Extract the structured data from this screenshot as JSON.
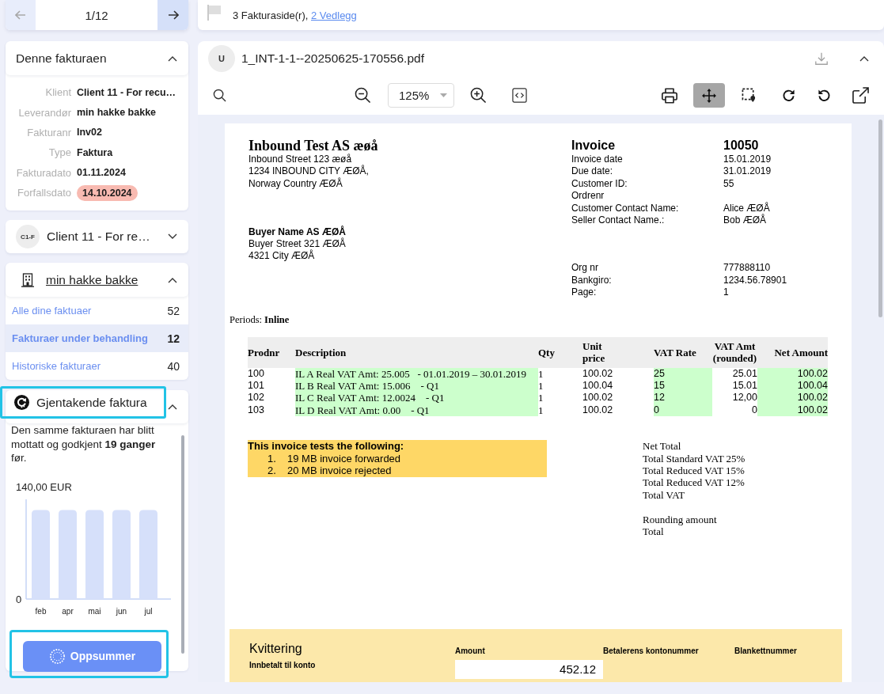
{
  "pager": {
    "position": "1/12",
    "previous_disabled": true
  },
  "invoice_card": {
    "title": "Denne fakturaen",
    "expanded": true,
    "fields": [
      {
        "label": "Klient",
        "value": "Client 11 - For recu…",
        "overdue": false
      },
      {
        "label": "Leverandør",
        "value": "min hakke bakke",
        "overdue": false
      },
      {
        "label": "Fakturanr",
        "value": "Inv02",
        "overdue": false
      },
      {
        "label": "Type",
        "value": "Faktura",
        "overdue": false
      },
      {
        "label": "Fakturadato",
        "value": "01.11.2024",
        "overdue": false
      },
      {
        "label": "Forfallsdato",
        "value": "14.10.2024",
        "overdue": true
      }
    ]
  },
  "client_card": {
    "avatar": "C1-F",
    "name": "Client 11 - For re…",
    "expanded": false
  },
  "supplier_card": {
    "name": "min hakke bakke",
    "expanded": true,
    "items": [
      {
        "label": "Alle dine faktuaer",
        "count": "52",
        "selected": false
      },
      {
        "label": "Fakturaer under behandling",
        "count": "12",
        "selected": true
      },
      {
        "label": "Historiske fakturaer",
        "count": "40",
        "selected": false
      }
    ]
  },
  "recurring_card": {
    "title": "Gjentakende faktura",
    "expanded": true,
    "header_highlighted": true,
    "message": "Den samme fakturaen har blitt mottatt og godkjent **19 ganger** før.",
    "chart_data": {
      "type": "bar",
      "categories": [
        "feb",
        "apr",
        "mai",
        "jun",
        "jul"
      ],
      "values": [
        111,
        111,
        111,
        111,
        111
      ],
      "ylim": [
        0,
        140
      ],
      "yticks": [
        0,
        {
          "value": 140,
          "label": "140,00 EUR"
        }
      ]
    },
    "button": {
      "label": "Oppsummer",
      "highlighted": true
    }
  },
  "top_bar": {
    "summary": "3 Fakturaside(r),",
    "attachments_link": "2 Vedlegg"
  },
  "document": {
    "avatar": "U",
    "filename": "1_INT-1-1--20250625-170556.pdf",
    "expanded": true,
    "zoom": "125%",
    "tools": [
      {
        "kind": "print",
        "selected": false
      },
      {
        "kind": "pan",
        "selected": true
      },
      {
        "kind": "select_area",
        "selected": false
      },
      {
        "kind": "rotate_right",
        "selected": false
      },
      {
        "kind": "rotate_left",
        "selected": false
      },
      {
        "kind": "open_external",
        "selected": false
      }
    ],
    "invoice": {
      "seller": {
        "name": "Inbound Test AS æøå",
        "address": [
          "Inbound Street 123 æøå",
          "1234 INBOUND CITY ÆØÅ,",
          "Norway Country ÆØÅ"
        ]
      },
      "buyer": {
        "name": "Buyer Name AS ÆØÅ",
        "address": [
          "Buyer Street 321 ÆØÅ",
          "4321 City ÆØÅ"
        ]
      },
      "title": "Invoice",
      "number": "10050",
      "details": [
        {
          "label": "Invoice date",
          "value": "15.01.2019"
        },
        {
          "label": "Due date:",
          "value": "31.01.2019"
        },
        {
          "label": "Customer ID:",
          "value": "55"
        },
        {
          "label": "Ordrenr"
        },
        {
          "label": "Customer Contact Name:",
          "value": "Alice ÆØÅ"
        },
        {
          "label": "Seller Contact Name.:",
          "value": "Bob ÆØÅ"
        }
      ],
      "bank_details": [
        {
          "label": "Org nr",
          "value": "777888110"
        },
        {
          "label": "Bankgiro:",
          "value": "1234.56.78901"
        },
        {
          "label": "Page:",
          "value": "1"
        }
      ],
      "periods": "Periods: **Inline**",
      "table": {
        "columns": [
          {
            "label": "Prodnr",
            "highlighted": false
          },
          {
            "label": "Description",
            "highlighted": true
          },
          {
            "label": "Qty",
            "highlighted": false
          },
          {
            "label": "Unit price",
            "highlighted": false
          },
          {
            "label": "VAT Rate",
            "highlighted": true
          },
          {
            "label": "VAT Amt (rounded)",
            "highlighted": false
          },
          {
            "label": "Net Amount",
            "highlighted": true
          }
        ],
        "rows": [
          [
            "100",
            "IL A Real VAT Amt: 25.005   - 01.01.2019 – 30.01.2019",
            "1",
            "100.02",
            "25",
            "25.01",
            "100.02"
          ],
          [
            "101",
            "IL B Real VAT Amt: 15.006    - Q1",
            "1",
            "100.04",
            "15",
            "15.01",
            "100.04"
          ],
          [
            "102",
            "IL C Real VAT Amt: 12.0024    - Q1",
            "1",
            "100.02",
            "12",
            "12,00",
            "100.02"
          ],
          [
            "103",
            "IL D Real VAT Amt: 0.00    - Q1",
            "1",
            "100.02",
            "0",
            "0",
            "100.02"
          ]
        ]
      },
      "note": {
        "title": "This invoice tests the following:",
        "items": [
          {
            "number": "1.",
            "text": "19 MB invoice forwarded"
          },
          {
            "number": "2.",
            "text": "20 MB invoice rejected"
          }
        ]
      },
      "totals": [
        [
          "Net Total",
          "Total Standard VAT 25%",
          "Total Reduced VAT 15%",
          "Total Reduced VAT 12%",
          "Total VAT"
        ],
        [
          "Rounding amount",
          "Total"
        ]
      ],
      "receipt": {
        "title": "Kvittering",
        "subtitle": "Innbetalt til konto",
        "amount_label": "Amount",
        "amount": "452.12",
        "payer_account_label": "Betalerens kontonummer",
        "form_number_label": "Blankettnummer"
      }
    }
  }
}
